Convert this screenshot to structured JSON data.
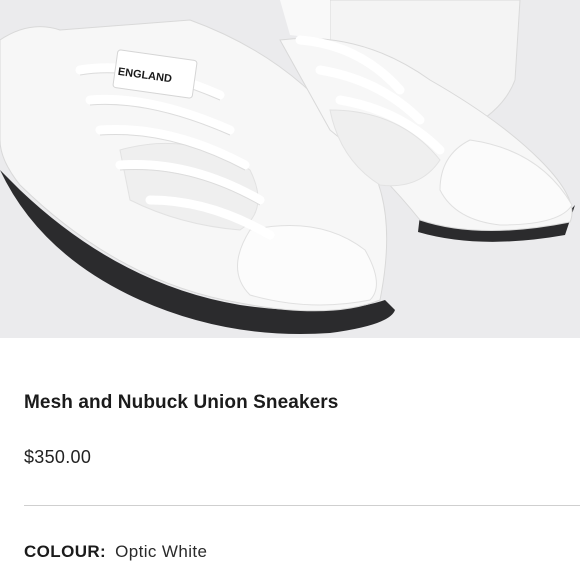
{
  "product": {
    "image_alt": "White mesh and nubuck sneakers",
    "brand_tag_text": "ENGLAND",
    "title": "Mesh and Nubuck Union Sneakers",
    "price": "$350.00",
    "colour_label": "COLOUR:",
    "colour_value": "Optic White"
  },
  "colors": {
    "image_background": "#ebebed",
    "sole": "#2b2b2d",
    "divider": "#cfcfcf"
  }
}
